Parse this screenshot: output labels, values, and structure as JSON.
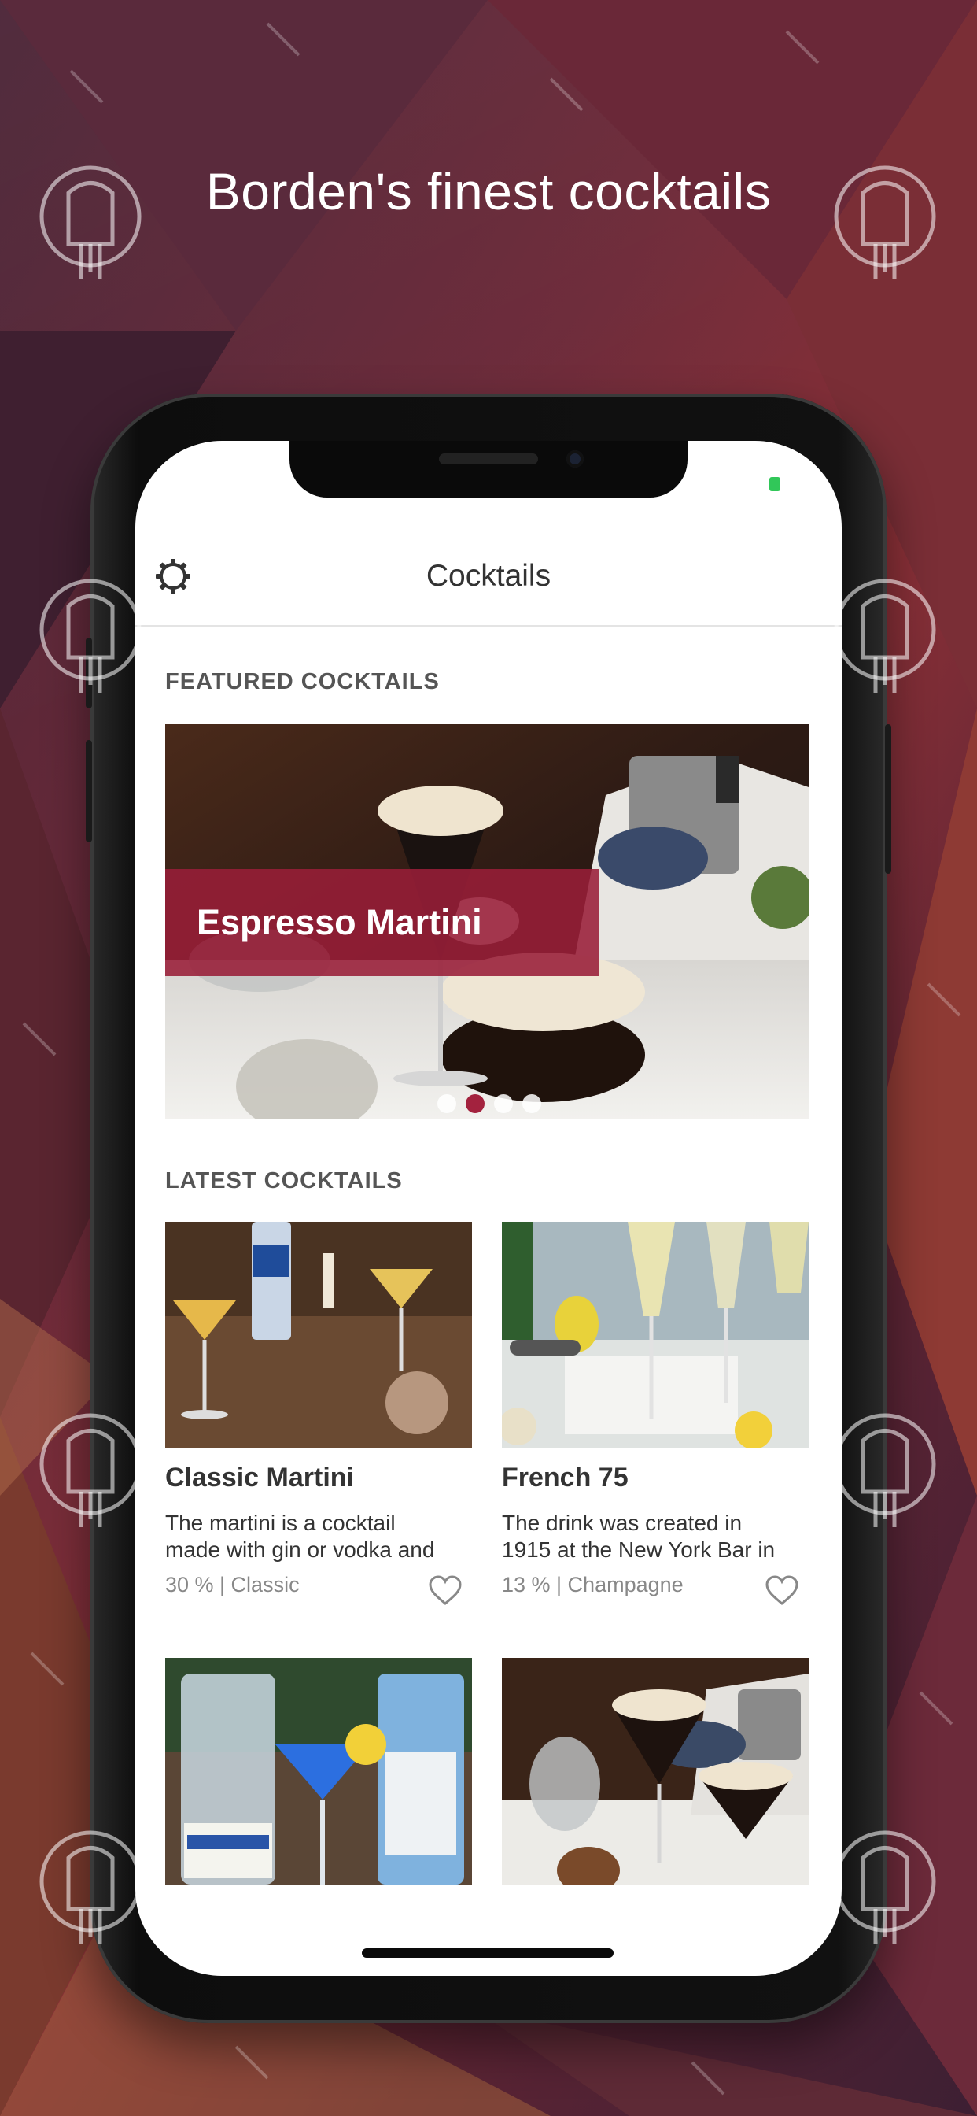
{
  "headline": "Borden's finest cocktails",
  "app": {
    "title": "Cocktails",
    "settings_icon": "gear-icon"
  },
  "featured": {
    "section_title": "FEATURED COCKTAILS",
    "slides_count": 4,
    "active_slide": 2,
    "caption": "Espresso Martini"
  },
  "latest": {
    "section_title": "LATEST COCKTAILS",
    "cards": [
      {
        "name": "Classic Martini",
        "desc_line1": "The martini is a cocktail",
        "desc_line2": "made with gin or vodka and",
        "meta": "30 % | Classic"
      },
      {
        "name": "French 75",
        "desc_line1": "The drink was created in",
        "desc_line2": "1915 at the New York Bar in",
        "meta": "13 % | Champagne"
      },
      {
        "name": "",
        "desc_line1": "",
        "desc_line2": "",
        "meta": ""
      },
      {
        "name": "",
        "desc_line1": "",
        "desc_line2": "",
        "meta": ""
      }
    ]
  },
  "colors": {
    "accent": "#a3223e",
    "caption_bg": "#981e38",
    "battery": "#31c759",
    "background_dark": "#4a2436",
    "background_red": "#8a3037"
  }
}
